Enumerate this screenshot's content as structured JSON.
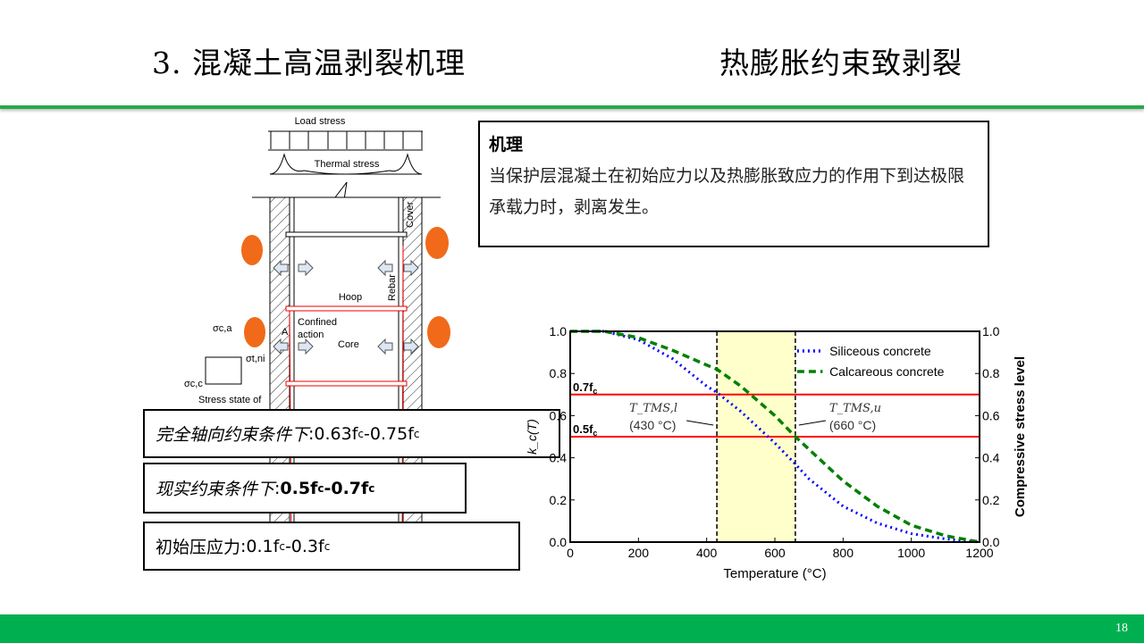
{
  "header": {
    "title": "3. 混凝土高温剥裂机理",
    "subtitle": "热膨胀约束致剥裂"
  },
  "mechanism": {
    "heading": "机理",
    "body": "当保护层混凝土在初始应力以及热膨胀致应力的作用下到达极限承载力时，剥离发生。"
  },
  "conditions": [
    {
      "label": "完全轴向约束条件下",
      "sep": ": ",
      "value": "0.63f",
      "sub1": "c",
      "mid": "-0.75f",
      "sub2": "c"
    },
    {
      "label": "现实约束条件下",
      "sep": ": ",
      "value": "0.5f",
      "sub1": "c",
      "mid": "-0.7f",
      "sub2": "c"
    },
    {
      "label": "初始压应力",
      "sep": ": ",
      "value": "0.1f",
      "sub1": "c",
      "mid": "-0.3f",
      "sub2": "c"
    }
  ],
  "diagram": {
    "load_stress": "Load stress",
    "thermal_stress": "Thermal stress",
    "cover": "Cover",
    "rebar": "Rebar",
    "hoop": "Hoop",
    "confined": "Confined",
    "action": "action",
    "core": "Core",
    "point": "A",
    "sigma_ca": "σc,a",
    "sigma_tni": "σt,ni",
    "sigma_cc": "σc,c",
    "stress_state": "Stress state of"
  },
  "chart_data": {
    "type": "line",
    "xlabel": "Temperature (°C)",
    "ylabel": "k_c(T)",
    "ylabel_right": "Compressive stress level",
    "xlim": [
      0,
      1200
    ],
    "ylim": [
      0,
      1.0
    ],
    "xticks": [
      "0",
      "200",
      "400",
      "600",
      "800",
      "1000",
      "1200"
    ],
    "yticks": [
      "0.0",
      "0.2",
      "0.4",
      "0.6",
      "0.8",
      "1.0"
    ],
    "legend_position": "top-right",
    "series": [
      {
        "name": "Siliceous concrete",
        "color": "#0000ff",
        "style": "dotted",
        "x": [
          0,
          100,
          200,
          300,
          400,
          430,
          500,
          600,
          660,
          700,
          800,
          900,
          1000,
          1100,
          1200
        ],
        "y": [
          1,
          1,
          0.96,
          0.87,
          0.74,
          0.71,
          0.62,
          0.47,
          0.37,
          0.3,
          0.17,
          0.09,
          0.04,
          0.015,
          0
        ]
      },
      {
        "name": "Calcareous concrete",
        "color": "#008000",
        "style": "dashed",
        "x": [
          0,
          100,
          200,
          300,
          400,
          430,
          500,
          600,
          660,
          700,
          800,
          900,
          1000,
          1100,
          1200
        ],
        "y": [
          1,
          1,
          0.97,
          0.91,
          0.84,
          0.82,
          0.74,
          0.6,
          0.5,
          0.44,
          0.29,
          0.17,
          0.08,
          0.03,
          0
        ]
      }
    ],
    "hlines": [
      {
        "y": 0.7,
        "label": "0.7f",
        "sub": "c",
        "color": "#ff0000"
      },
      {
        "y": 0.5,
        "label": "0.5f",
        "sub": "c",
        "color": "#ff0000"
      }
    ],
    "vlines": [
      {
        "x": 430,
        "label": "T_TMS,l",
        "value": "(430 °C)"
      },
      {
        "x": 660,
        "label": "T_TMS,u",
        "value": "(660 °C)"
      }
    ],
    "shaded": {
      "x": [
        430,
        660
      ],
      "color": "#ffffcc"
    }
  },
  "page_number": "18"
}
